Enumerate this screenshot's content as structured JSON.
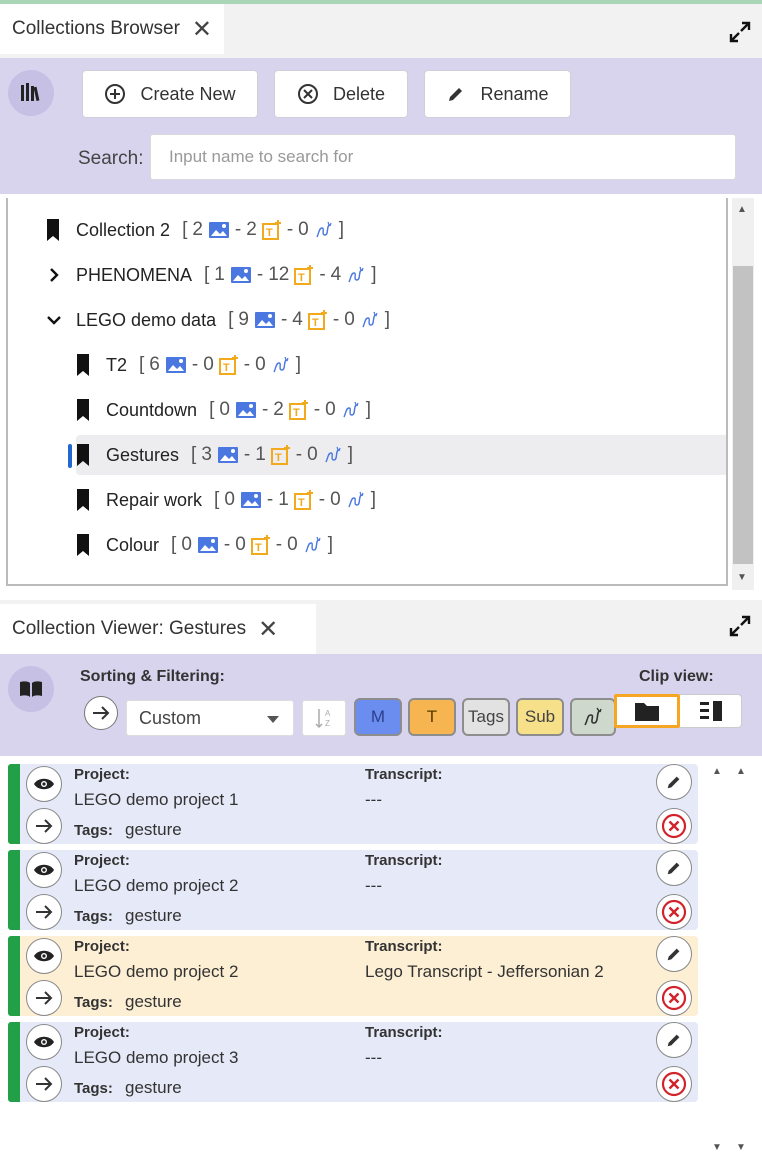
{
  "browser": {
    "tab_title": "Collections Browser",
    "close_glyph": "✕",
    "buttons": {
      "create": "Create New",
      "delete": "Delete",
      "rename": "Rename"
    },
    "search_label": "Search:",
    "search_placeholder": "Input name to search for",
    "tree": [
      {
        "name": "Collection 2",
        "kind": "collection",
        "clips": "2",
        "transcripts": "2",
        "subs": "0"
      },
      {
        "name": "PHENOMENA",
        "kind": "group-collapsed",
        "clips": "1",
        "transcripts": "12",
        "subs": "4"
      },
      {
        "name": "LEGO demo data",
        "kind": "group-expanded",
        "clips": "9",
        "transcripts": "4",
        "subs": "0"
      },
      {
        "name": "T2",
        "kind": "collection",
        "clips": "6",
        "transcripts": "0",
        "subs": "0"
      },
      {
        "name": "Countdown",
        "kind": "collection",
        "clips": "0",
        "transcripts": "2",
        "subs": "0"
      },
      {
        "name": "Gestures",
        "kind": "collection",
        "clips": "3",
        "transcripts": "1",
        "subs": "0",
        "selected": true
      },
      {
        "name": "Repair work",
        "kind": "collection",
        "clips": "0",
        "transcripts": "1",
        "subs": "0"
      },
      {
        "name": "Colour",
        "kind": "collection",
        "clips": "0",
        "transcripts": "0",
        "subs": "0"
      }
    ]
  },
  "viewer": {
    "tab_title": "Collection Viewer: Gestures",
    "close_glyph": "✕",
    "sorting_label": "Sorting & Filtering:",
    "clip_view_label": "Clip view:",
    "sort_select": "Custom",
    "filters": {
      "m": "M",
      "t": "T",
      "tags": "Tags",
      "sub": "Sub"
    },
    "items": [
      {
        "project_label": "Project:",
        "project": "LEGO demo project 1",
        "transcript_label": "Transcript:",
        "transcript": "---",
        "tags_label": "Tags:",
        "tags": "gesture",
        "bg": "#e6eaf8"
      },
      {
        "project_label": "Project:",
        "project": "LEGO demo project 2",
        "transcript_label": "Transcript:",
        "transcript": "---",
        "tags_label": "Tags:",
        "tags": "gesture",
        "bg": "#e6eaf8"
      },
      {
        "project_label": "Project:",
        "project": "LEGO demo project 2",
        "transcript_label": "Transcript:",
        "transcript": "Lego Transcript - Jeffersonian 2",
        "tags_label": "Tags:",
        "tags": "gesture",
        "bg": "#fdefd4"
      },
      {
        "project_label": "Project:",
        "project": "LEGO demo project 3",
        "transcript_label": "Transcript:",
        "transcript": "---",
        "tags_label": "Tags:",
        "tags": "gesture",
        "bg": "#e6eaf8"
      }
    ]
  },
  "colors": {
    "accent": "#d8d4ee",
    "green": "#21a047",
    "blue_filter": "#6b8df0",
    "orange_filter": "#f7b551",
    "yellow_filter": "#f6e08a",
    "highlight": "#f6a623"
  }
}
